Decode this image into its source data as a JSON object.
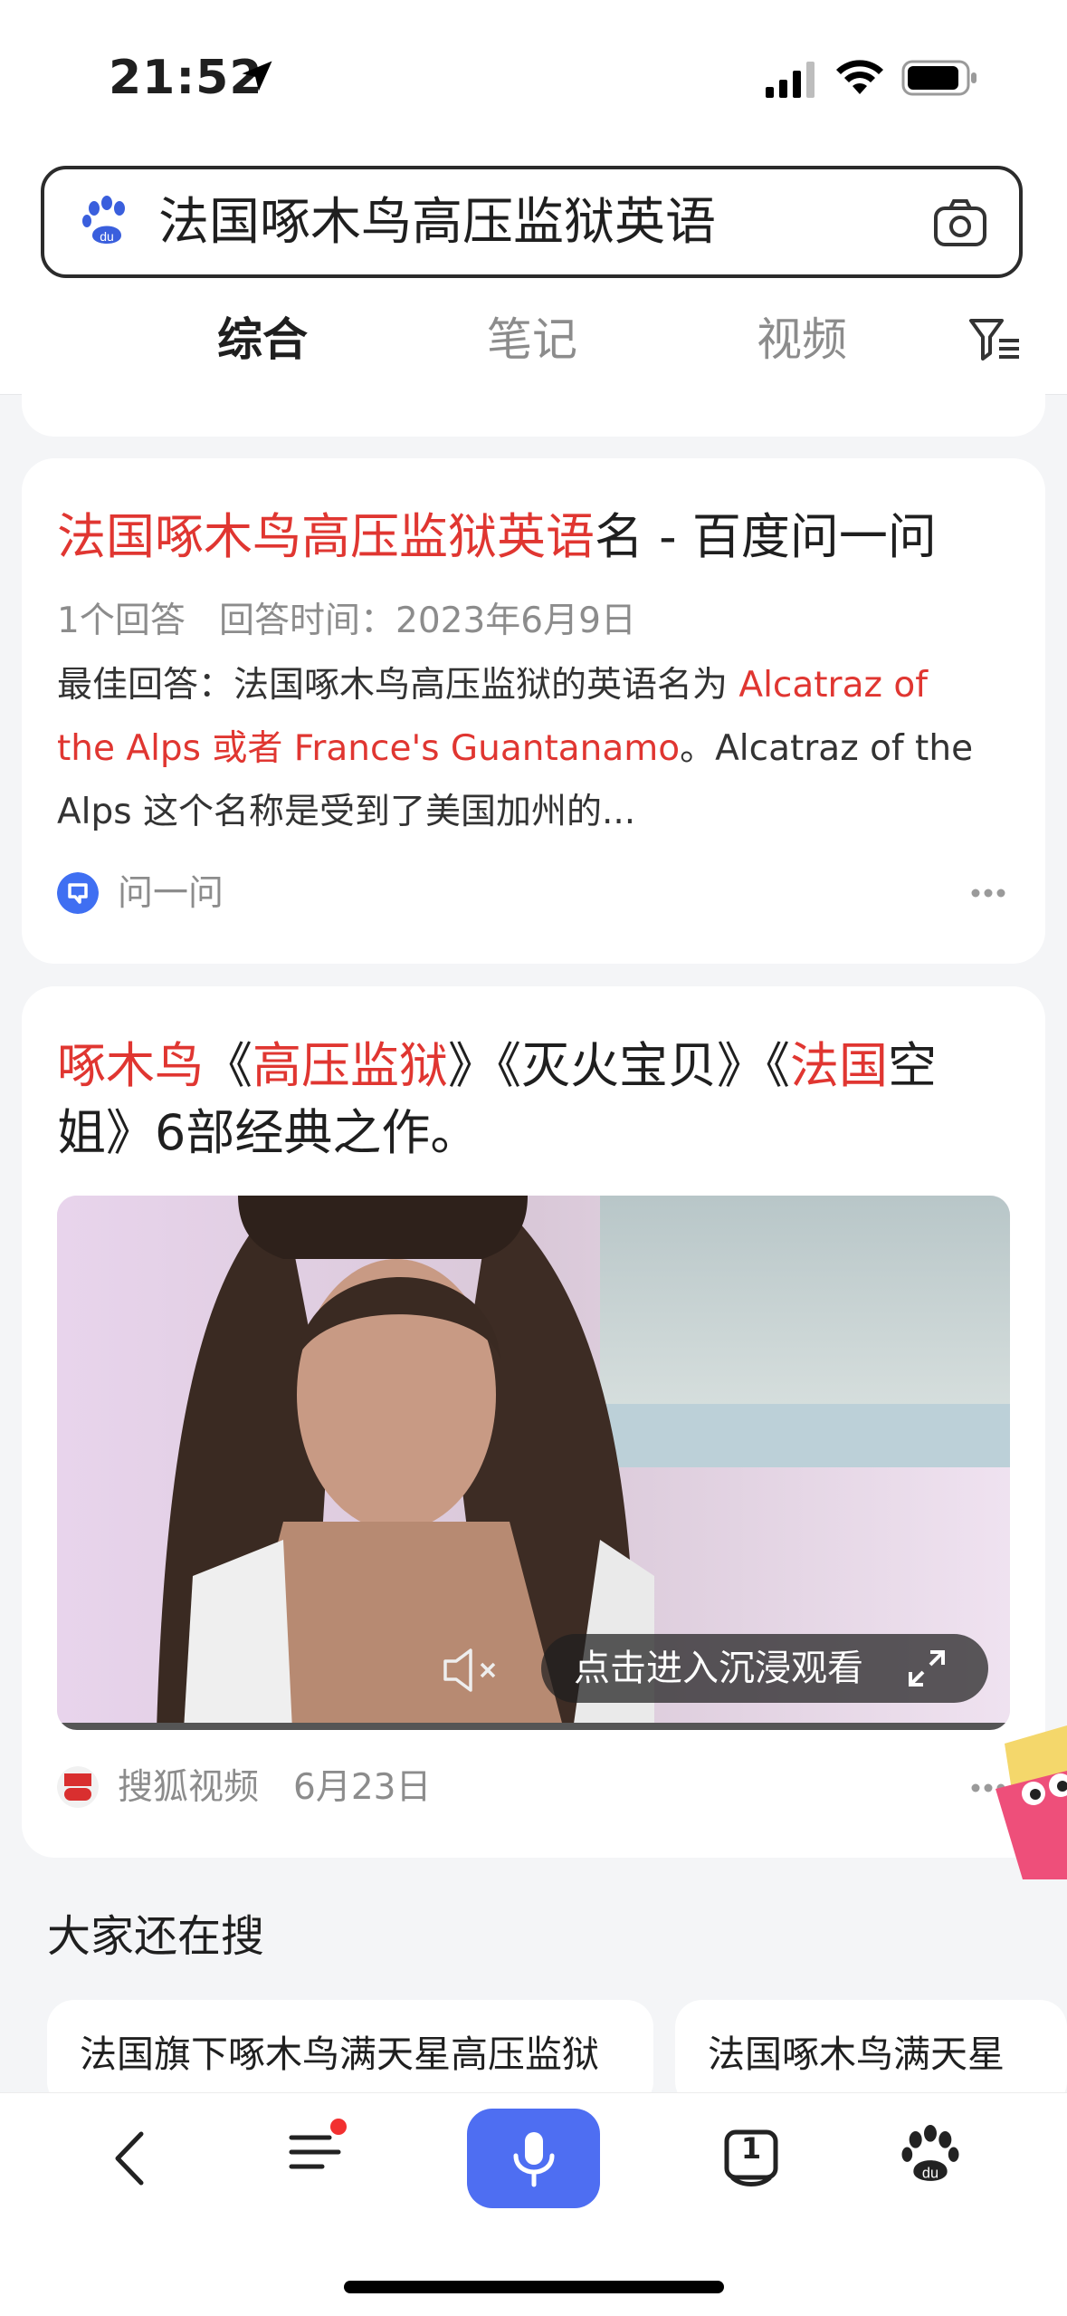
{
  "status_bar": {
    "time": "21:52"
  },
  "search": {
    "query": "法国啄木鸟高压监狱英语"
  },
  "tabs": [
    {
      "label": "综合",
      "active": true
    },
    {
      "label": "笔记",
      "active": false
    },
    {
      "label": "视频",
      "active": false
    }
  ],
  "result1": {
    "title_highlight": "法国啄木鸟高压监狱英语",
    "title_rest": "名 - 百度问一问",
    "meta_answers": "1个回答",
    "meta_time": "回答时间：2023年6月9日",
    "body_prefix": "最佳回答：法国啄木鸟高压监狱的英语名为 ",
    "body_highlight1": "Alcatraz of",
    "body_highlight2": "the Alps 或者 France's Guantanamo",
    "body_suffix1": "。Alcatraz of the",
    "body_line3": "Alps 这个名称是受到了美国加州的...",
    "source_name": "问一问"
  },
  "result2": {
    "title_p1": "啄木鸟",
    "title_p2": "《",
    "title_p3": "高压监狱",
    "title_p4": "》《灭火宝贝》《",
    "title_p5": "法国",
    "title_p6": "空",
    "title_line2": "姐》6部经典之作。",
    "immerse_label": "点击进入沉浸观看",
    "source_name": "搜狐视频",
    "source_date": "6月23日"
  },
  "related": {
    "section_title": "大家还在搜",
    "chips": [
      "法国旗下啄木鸟满天星高压监狱",
      "法国啄木鸟满天星"
    ]
  },
  "bottom_nav": {
    "tab_count": "1"
  },
  "colors": {
    "accent": "#4e6ef2",
    "highlight": "#e03631"
  }
}
